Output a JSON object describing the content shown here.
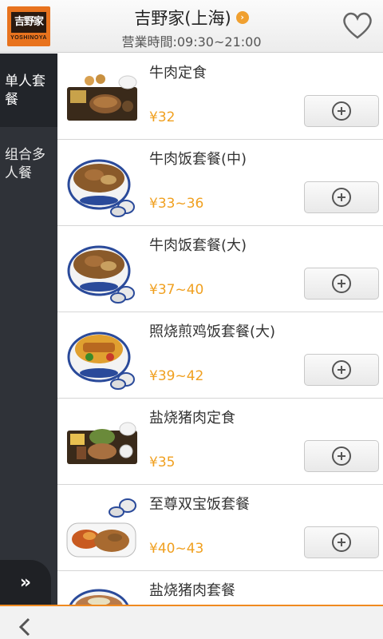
{
  "header": {
    "logo_text": "吉野家",
    "logo_sub": "YOSHINOYA",
    "store_name": "吉野家(上海)",
    "hours": "营業時間:09:30~21:00"
  },
  "sidebar": {
    "items": [
      {
        "label": "单人套餐"
      },
      {
        "label": "组合多人餐"
      }
    ]
  },
  "menu": {
    "items": [
      {
        "name": "牛肉定食",
        "price": "¥32"
      },
      {
        "name": "牛肉饭套餐(中)",
        "price": "¥33~36"
      },
      {
        "name": "牛肉饭套餐(大)",
        "price": "¥37~40"
      },
      {
        "name": "照烧煎鸡饭套餐(大)",
        "price": "¥39~42"
      },
      {
        "name": "盐烧猪肉定食",
        "price": "¥35"
      },
      {
        "name": "至尊双宝饭套餐",
        "price": "¥40~43"
      },
      {
        "name": "盐烧猪肉套餐",
        "price": ""
      }
    ]
  },
  "colors": {
    "brand": "#e8731e",
    "price": "#f0a020",
    "sidebar": "#2f3238"
  },
  "icons": [
    "heart-icon",
    "chevron-right-icon",
    "add-circle-icon",
    "double-chevron-icon",
    "back-arrow-icon"
  ]
}
